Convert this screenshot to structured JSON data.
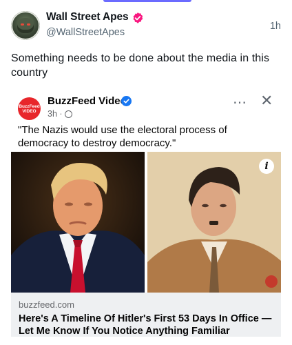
{
  "post": {
    "author_name": "Wall Street Apes",
    "handle": "@WallStreetApes",
    "time": "1h",
    "text": "Something needs to be done about the media in this country"
  },
  "embed": {
    "page_name": "BuzzFeed Video",
    "page_logo_text": "BuzzFeed VIDEO",
    "time": "3h ·",
    "more_icon": "⋯",
    "close_icon": "✕",
    "quote": "\"The Nazis would use the electoral process of democracy to destroy democracy.\"",
    "info_icon": "i",
    "link_domain": "buzzfeed.com",
    "link_title": "Here's A Timeline Of Hitler's First 53 Days In Office — Let Me Know If You Notice Anything Familiar"
  },
  "colors": {
    "verified_x": "#f91880",
    "verified_fb": "#1877f2",
    "buzzfeed_red": "#e8262b",
    "accent_bar": "#6b6bff"
  }
}
